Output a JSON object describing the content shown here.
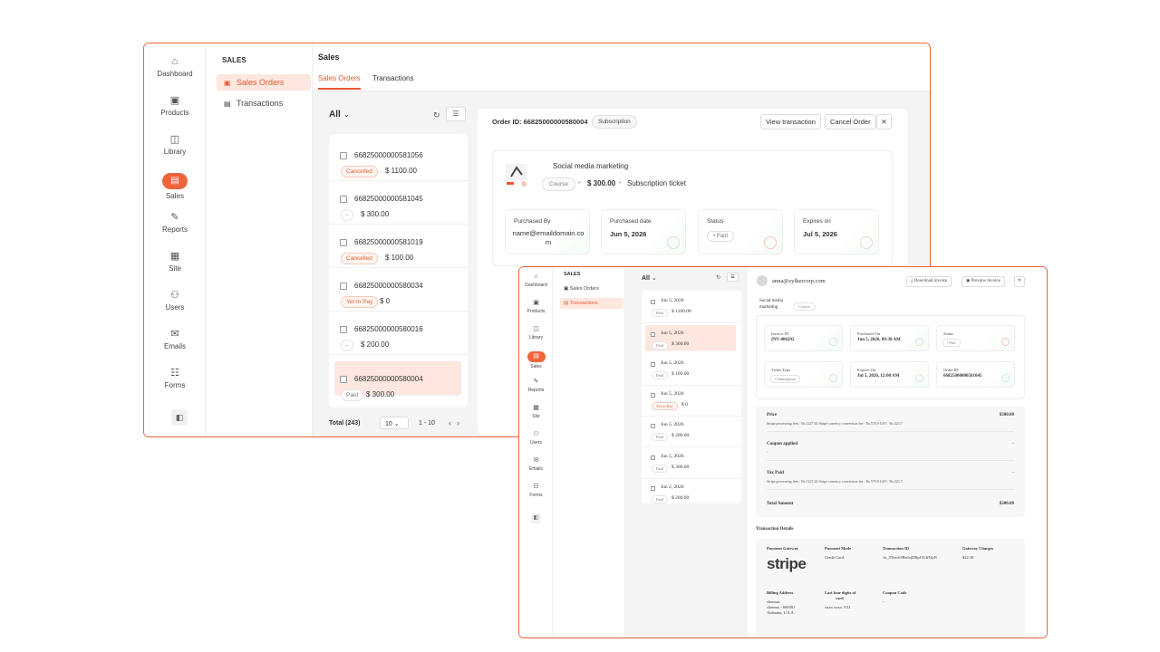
{
  "win1": {
    "rail": [
      {
        "label": "Dashboard",
        "icon": "⌂"
      },
      {
        "label": "Products",
        "icon": "▣"
      },
      {
        "label": "Library",
        "icon": "◫"
      },
      {
        "label": "Sales",
        "icon": "▤",
        "active": true
      },
      {
        "label": "Reports",
        "icon": "✎"
      },
      {
        "label": "Site",
        "icon": "▦"
      },
      {
        "label": "Users",
        "icon": "⚇"
      },
      {
        "label": "Emails",
        "icon": "✉"
      },
      {
        "label": "Forms",
        "icon": "☷"
      }
    ],
    "subnav": {
      "heading": "SALES",
      "items": [
        {
          "label": "Sales Orders",
          "active": true
        },
        {
          "label": "Transactions",
          "active": false
        }
      ]
    },
    "page_title": "Sales",
    "tabs": [
      "Sales Orders",
      "Transactions"
    ],
    "filter_label": "All",
    "orders": [
      {
        "id": "66825000000581056",
        "status": "Cancelled",
        "amount": "$ 1100.00"
      },
      {
        "id": "66825000000581045",
        "status": "-",
        "amount": "$ 300.00"
      },
      {
        "id": "66825000000581019",
        "status": "Cancelled",
        "amount": "$ 100.00"
      },
      {
        "id": "66825000000580034",
        "status": "Yet to Pay",
        "amount": "$ 0"
      },
      {
        "id": "66825000000580016",
        "status": "-",
        "amount": "$ 200.00"
      },
      {
        "id": "66825000000580004",
        "status": "Paid",
        "amount": "$ 300.00"
      }
    ],
    "footer": {
      "total": "Total (243)",
      "per_page": "10",
      "range": "1 - 10"
    },
    "detail": {
      "order_id": "Order ID: 66825000000580004",
      "type_chip": "Subscription",
      "view_transaction": "View transaction",
      "cancel_order": "Cancel Order",
      "close": "✕",
      "product_name": "Social media marketing",
      "product_chip": "Course",
      "price": "$ 300.00",
      "ticket": "Subscription ticket",
      "purchased_by_label": "Purchased By",
      "purchased_by": "name@emaildomain.com",
      "purchased_date_label": "Purchased date",
      "purchased_date": "Jun 5, 2026",
      "status_label": "Status",
      "status": "Paid",
      "expires_label": "Expires on",
      "expires": "Jul 5, 2026"
    }
  },
  "win2": {
    "rail": [
      {
        "label": "Dashboard",
        "icon": "⌂"
      },
      {
        "label": "Products",
        "icon": "▣"
      },
      {
        "label": "Library",
        "icon": "◫"
      },
      {
        "label": "Sales",
        "icon": "▤",
        "active": true
      },
      {
        "label": "Reports",
        "icon": "✎"
      },
      {
        "label": "Site",
        "icon": "▦"
      },
      {
        "label": "Users",
        "icon": "⚇"
      },
      {
        "label": "Emails",
        "icon": "✉"
      },
      {
        "label": "Forms",
        "icon": "☷"
      }
    ],
    "subnav": {
      "heading": "SALES",
      "items": [
        {
          "label": "Sales Orders",
          "active": false
        },
        {
          "label": "Transactions",
          "active": true
        }
      ]
    },
    "filter_label": "All",
    "transactions": [
      {
        "date": "Jun 5, 2026",
        "status": "Paid",
        "amount": "$ 1100.00"
      },
      {
        "date": "Jun 5, 2026",
        "status": "Paid",
        "amount": "$ 300.00"
      },
      {
        "date": "Jun 5, 2026",
        "status": "Paid",
        "amount": "$ 100.00"
      },
      {
        "date": "Jun 5, 2026",
        "status": "Yet to Pay",
        "amount": "$ 0"
      },
      {
        "date": "Jun 5, 2026",
        "status": "Paid",
        "amount": "$ 200.00"
      },
      {
        "date": "Jun 5, 2026",
        "status": "Paid",
        "amount": "$ 300.00"
      },
      {
        "date": "Jun 2, 2026",
        "status": "Paid",
        "amount": "$ 200.00"
      }
    ],
    "detail": {
      "email": "anna@zylkercorp.com",
      "download_invoice": "Download invoice",
      "preview_invoice": "Preview invoice",
      "close": "✕",
      "product_name": "Social media marketing",
      "product_chip": "Course",
      "invoice_id_label": "Invoice ID",
      "invoice_id": "INV-006292",
      "purchased_on_label": "Purchased On",
      "purchased_on": "Jun 5, 2026, 09:30 AM",
      "status_label": "Status",
      "status": "Paid",
      "ticket_type_label": "Ticket Type",
      "ticket_type": "Subscription",
      "expires_on_label": "Expires On",
      "expires_on": "Jul 5, 2026, 12:00 AM",
      "order_id_label": "Order ID",
      "order_id": "66825000000581045",
      "price_label": "Price",
      "price": "$300.00",
      "price_note": "Stripe processing fees : Rs.1227.44 Stripe currency conversion fee : Rs.570.9 GST : Rs.323.7",
      "coupon_label": "Coupon applied",
      "coupon_value": "-",
      "coupon_sub": "-",
      "tax_label": "Tax Paid",
      "tax_value": "-",
      "tax_note": "Stripe processing fees : Rs.1227.44 Stripe currency conversion fee : Rs.570.9 GST : Rs.323.7",
      "total_label": "Total Amount",
      "total": "$300.00",
      "transaction_details_heading": "Transaction Details",
      "gateway_label": "Payment Gateway",
      "gateway": "stripe",
      "mode_label": "Payment Mode",
      "mode": "Credit Card",
      "txn_id_label": "Transaction ID",
      "txn_id": "ch_3Tezch3Bs6vjDRpI1UfiFfpN",
      "charges_label": "Gateway Charges",
      "charges": "$22.30",
      "billing_label": "Billing Address",
      "billing_1": "chennai",
      "billing_2": "chennai - 600001",
      "billing_3": "Alabama, U.S.A.",
      "card_label_1": "Last four digits of",
      "card_label_2": "card",
      "card": "xxxx xxxx 1111",
      "coupon_code_label": "Coupon Code",
      "coupon_code": "-"
    }
  },
  "colors": {
    "accent": "#f0643c",
    "accent_light": "#fde7df"
  }
}
